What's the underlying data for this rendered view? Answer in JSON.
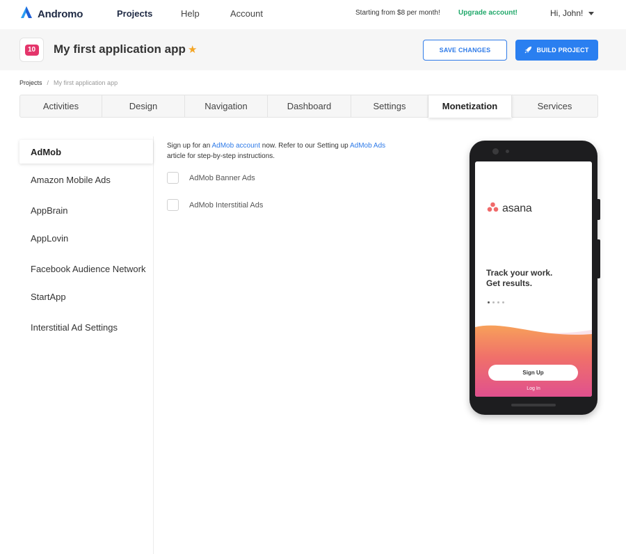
{
  "nav": {
    "brand": "Andromo",
    "links": [
      "Projects",
      "Help",
      "Account"
    ],
    "promo": "Starting from $8 per month!",
    "upgrade": "Upgrade account!",
    "user": "Hi, John!"
  },
  "project": {
    "icon_text": "10",
    "title": "My first application app",
    "save_label": "SAVE CHANGES",
    "build_label": "BUILD PROJECT"
  },
  "breadcrumb": {
    "root": "Projects",
    "separator": "/",
    "current": "My first application app"
  },
  "tabs": [
    "Activities",
    "Design",
    "Navigation",
    "Dashboard",
    "Settings",
    "Monetization",
    "Services"
  ],
  "active_tab": "Monetization",
  "sidebar": {
    "items": [
      "AdMob",
      "Amazon Mobile Ads",
      "AppBrain",
      "AppLovin",
      "Facebook Audience Network",
      "StartApp",
      "Interstitial Ad Settings"
    ],
    "active": "AdMob"
  },
  "main": {
    "intro_prefix": "Sign up for an ",
    "intro_link1": "AdMob account",
    "intro_middle": " now. Refer to our Setting up ",
    "intro_link2": "AdMob Ads",
    "intro_suffix": "article for step-by-step instructions.",
    "options": [
      {
        "label": "AdMob Banner Ads",
        "checked": false
      },
      {
        "label": "AdMob Interstitial Ads",
        "checked": false
      }
    ]
  },
  "preview": {
    "logo_text": "asana",
    "tagline_line1": "Track your work.",
    "tagline_line2": "Get results.",
    "signup": "Sign Up",
    "login": "Log In"
  },
  "colors": {
    "accent": "#2a7ff0",
    "upgrade": "#20a86a",
    "star": "#f4a524",
    "asana": "#f06a6a"
  }
}
